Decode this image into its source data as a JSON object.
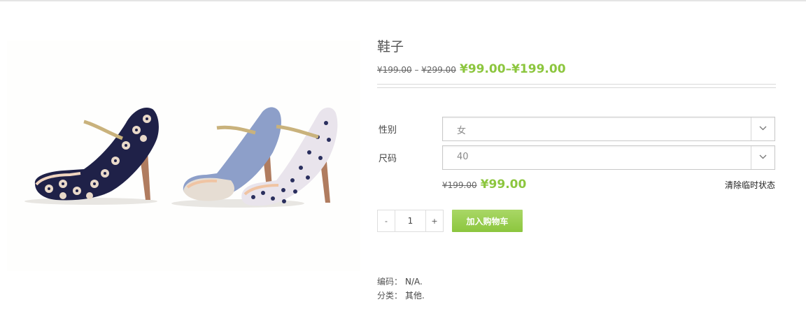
{
  "product": {
    "title": "鞋子",
    "price_range": {
      "old_min": "¥199.00",
      "old_separator": " – ",
      "old_max": "¥299.00",
      "new_min": "¥99.00",
      "new_separator": "–",
      "new_max": "¥199.00"
    }
  },
  "options": {
    "gender": {
      "label": "性别",
      "value": "女"
    },
    "size": {
      "label": "尺码",
      "value": "40"
    }
  },
  "variation_price": {
    "old": "¥199.00",
    "new": "¥99.00"
  },
  "reset_label": "清除临时状态",
  "quantity": {
    "minus": "-",
    "value": "1",
    "plus": "+"
  },
  "add_to_cart_label": "加入购物车",
  "meta": {
    "sku_label": "编码：",
    "sku_value": "N/A.",
    "category_label": "分类：",
    "category_value": "其他."
  },
  "colors": {
    "accent": "#8cc63e",
    "shoe_navy": "#1f2148",
    "heel_wood": "#b07c5f",
    "denim": "#8d9fc9"
  },
  "icons": [
    "chevron-down-icon"
  ]
}
